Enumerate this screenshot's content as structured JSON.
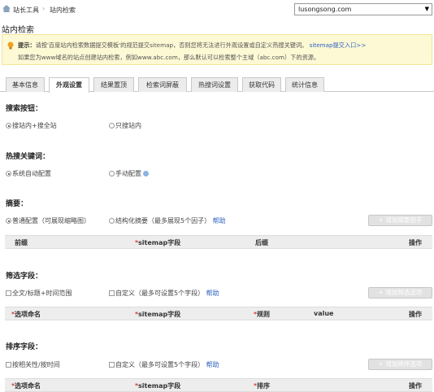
{
  "breadcrumb": {
    "home_icon": "home-icon",
    "items": [
      "站长工具",
      "站内检索"
    ],
    "separator": "›"
  },
  "site_select": {
    "value": "lusongsong.com"
  },
  "page_title": "站内检索",
  "notice": {
    "label": "提示：",
    "line1_text": "请按'百度站内检索数据提交模板'的规范提交sitemap，否则您将无法进行外观设置或自定义热搜关键词。",
    "line1_link": "sitemap提交入口>>",
    "line2_text": "如果您为www域名的站点创建站内检索，例如www.abc.com，那么默认可以检索整个主域（abc.com）下的资源。"
  },
  "tabs": [
    {
      "label": "基本信息",
      "active": false
    },
    {
      "label": "外观设置",
      "active": true
    },
    {
      "label": "结果置顶",
      "active": false
    },
    {
      "label": "检索词屏蔽",
      "active": false
    },
    {
      "label": "热搜词设置",
      "active": false
    },
    {
      "label": "获取代码",
      "active": false
    },
    {
      "label": "统计信息",
      "active": false
    }
  ],
  "search_button": {
    "title": "搜索按钮：",
    "option_a": "搜站内+搜全站",
    "option_b": "只搜站内",
    "selected": "option_a"
  },
  "hot_keywords": {
    "title": "热搜关键词：",
    "option_a": "系统自动配置",
    "option_b": "手动配置",
    "selected": "option_a"
  },
  "summary": {
    "title": "摘要：",
    "option_a": "普通配置（可展现缩略图）",
    "option_b": "结构化摘要（最多展现5个因子）",
    "help": "帮助",
    "selected": "option_a",
    "add_button": "+ 增加摘要因子",
    "columns": {
      "prefix": "前缀",
      "sitemap": "sitemap字段",
      "suffix": "后缀",
      "action": "操作"
    }
  },
  "filter": {
    "title": "筛选字段：",
    "option_a": "全文/标题+时间范围",
    "option_b": "自定义（最多可设置5个字段）",
    "help": "帮助",
    "add_button": "+ 增加筛选选项",
    "columns": {
      "name": "选项命名",
      "sitemap": "sitemap字段",
      "rule": "规则",
      "value": "value",
      "action": "操作"
    }
  },
  "sort": {
    "title": "排序字段：",
    "option_a": "按相关性/按时间",
    "option_b": "自定义（最多可设置5个字段）",
    "help": "帮助",
    "add_button": "+ 增加排序选项",
    "columns": {
      "name": "选项命名",
      "sitemap": "sitemap字段",
      "order": "排序",
      "action": "操作"
    }
  },
  "required_mark": "*"
}
